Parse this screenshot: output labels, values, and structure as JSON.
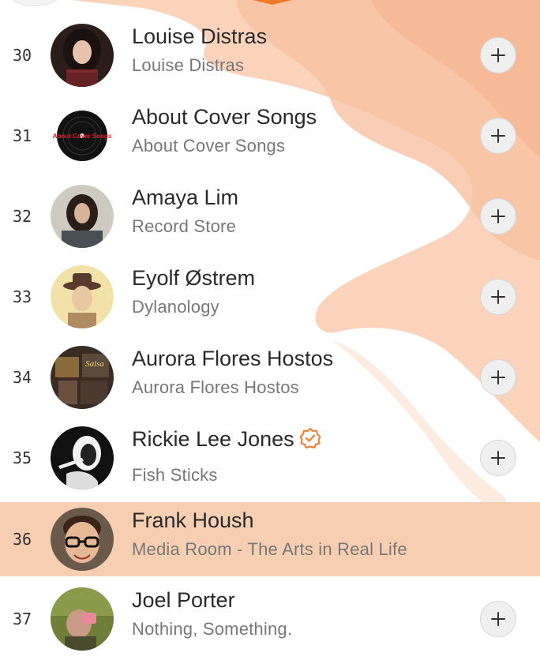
{
  "colors": {
    "accent": "#f07a2a",
    "highlight_row": "#f6ceb2",
    "decor_peach": "#f9c4a6"
  },
  "rows": [
    {
      "rank": "30",
      "title": "Louise Distras",
      "subtitle": "Louise Distras",
      "verified": false,
      "highlighted": false
    },
    {
      "rank": "31",
      "title": "About Cover Songs",
      "subtitle": "About Cover Songs",
      "avatar_text": "About Cover Songs",
      "verified": false,
      "highlighted": false
    },
    {
      "rank": "32",
      "title": "Amaya Lim",
      "subtitle": "Record Store",
      "verified": false,
      "highlighted": false
    },
    {
      "rank": "33",
      "title": "Eyolf Østrem",
      "subtitle": "Dylanology",
      "verified": false,
      "highlighted": false
    },
    {
      "rank": "34",
      "title": "Aurora Flores Hostos",
      "subtitle": "Aurora Flores Hostos",
      "avatar_text": "Salsa",
      "verified": false,
      "highlighted": false
    },
    {
      "rank": "35",
      "title": "Rickie Lee Jones",
      "subtitle": "Fish Sticks",
      "verified": true,
      "highlighted": false
    },
    {
      "rank": "36",
      "title": "Frank Housh",
      "subtitle": "Media Room - The Arts in Real Life",
      "verified": false,
      "highlighted": true
    },
    {
      "rank": "37",
      "title": "Joel Porter",
      "subtitle": "Nothing, Something.",
      "verified": false,
      "highlighted": false
    }
  ],
  "icons": {
    "add": "plus-icon",
    "verified": "verified-badge-icon"
  }
}
